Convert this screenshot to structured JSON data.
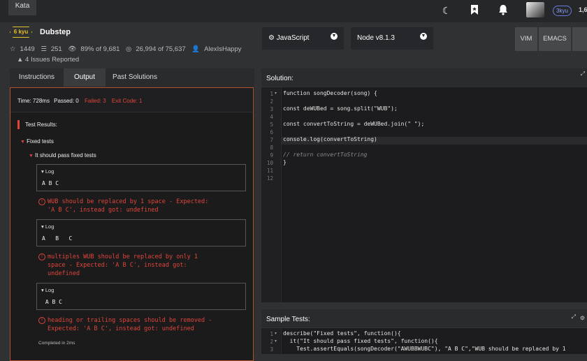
{
  "topbar": {
    "tab": "Kata",
    "rank": "3kyu",
    "honor": "1,6"
  },
  "kata": {
    "rank": "6 kyu",
    "title": "Dubstep",
    "stars": "1449",
    "collections": "251",
    "satisfaction": "89% of 9,681",
    "completed": "26,994 of 75,637",
    "author": "AlexIsHappy",
    "issues": "4 Issues Reported"
  },
  "toolbar": {
    "language": "JavaScript",
    "runtime": "Node v8.1.3",
    "modes": [
      "VIM",
      "EMACS"
    ]
  },
  "tabs": [
    "Instructions",
    "Output",
    "Past Solutions"
  ],
  "output": {
    "time": "Time: 728ms",
    "passed": "Passed: 0",
    "failed": "Failed: 3",
    "exit": "Exit Code: 1",
    "test_results": "Test Results:",
    "group": "Fixed tests",
    "subgroup": "It should pass fixed tests",
    "log_label": "Log",
    "logs": [
      "A B C",
      "A   B   C",
      " A B C"
    ],
    "failures": [
      "WUB should be replaced by 1 space - Expected:\n'A B C', instead got: undefined",
      "multiples WUB should be replaced by only 1\nspace - Expected: 'A B C', instead got:\nundefined",
      "heading or trailing spaces should be removed -\nExpected: 'A B C', instead got: undefined"
    ],
    "completed": "Completed in 2ms"
  },
  "solution": {
    "title": "Solution:",
    "line_numbers": [
      "1",
      "2",
      "3",
      "4",
      "5",
      "6",
      "7",
      "8",
      "9",
      "10",
      "11",
      "12"
    ],
    "lines": [
      "function songDecoder(song) {",
      "",
      "const deWUBed = song.split(\"WUB\");",
      "",
      "const convertToString = deWUBed.join(\" \");",
      "",
      "console.log(convertToString)",
      "",
      "// return convertToString",
      "}",
      "",
      ""
    ]
  },
  "sample": {
    "title": "Sample Tests:",
    "line_numbers": [
      "1",
      "2",
      "3"
    ],
    "lines": [
      "describe(\"Fixed tests\", function(){",
      "  it(\"It should pass fixed tests\", function(){",
      "    Test.assertEquals(songDecoder(\"AWUBBWUBC\"), \"A B C\",\"WUB should be replaced by 1"
    ]
  }
}
